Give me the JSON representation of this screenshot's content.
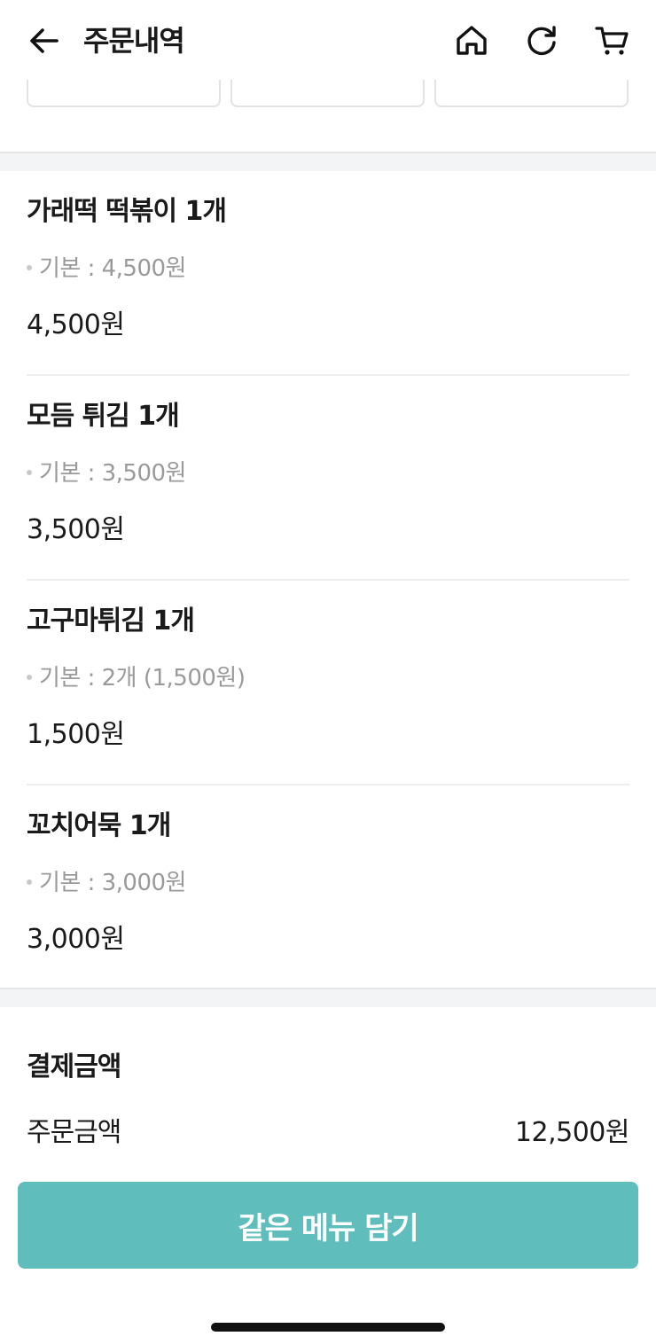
{
  "header": {
    "title": "주문내역",
    "icons": [
      "back-arrow-icon",
      "home-icon",
      "refresh-icon",
      "cart-icon"
    ]
  },
  "items": [
    {
      "name": "가래떡 떡볶이 1개",
      "option": "기본 : 4,500원",
      "price": "4,500원"
    },
    {
      "name": "모듬 튀김 1개",
      "option": "기본 : 3,500원",
      "price": "3,500원"
    },
    {
      "name": "고구마튀김 1개",
      "option": "기본 : 2개 (1,500원)",
      "price": "1,500원"
    },
    {
      "name": "꼬치어묵 1개",
      "option": "기본 : 3,000원",
      "price": "3,000원"
    }
  ],
  "payment": {
    "title": "결제금액",
    "order_amount_label": "주문금액",
    "order_amount_value": "12,500원"
  },
  "reorder_button": {
    "label": "같은 메뉴 담기"
  },
  "colors": {
    "accent": "#5fbdbb",
    "muted_text": "#9a9a9a",
    "divider_band": "#f3f4f6"
  }
}
